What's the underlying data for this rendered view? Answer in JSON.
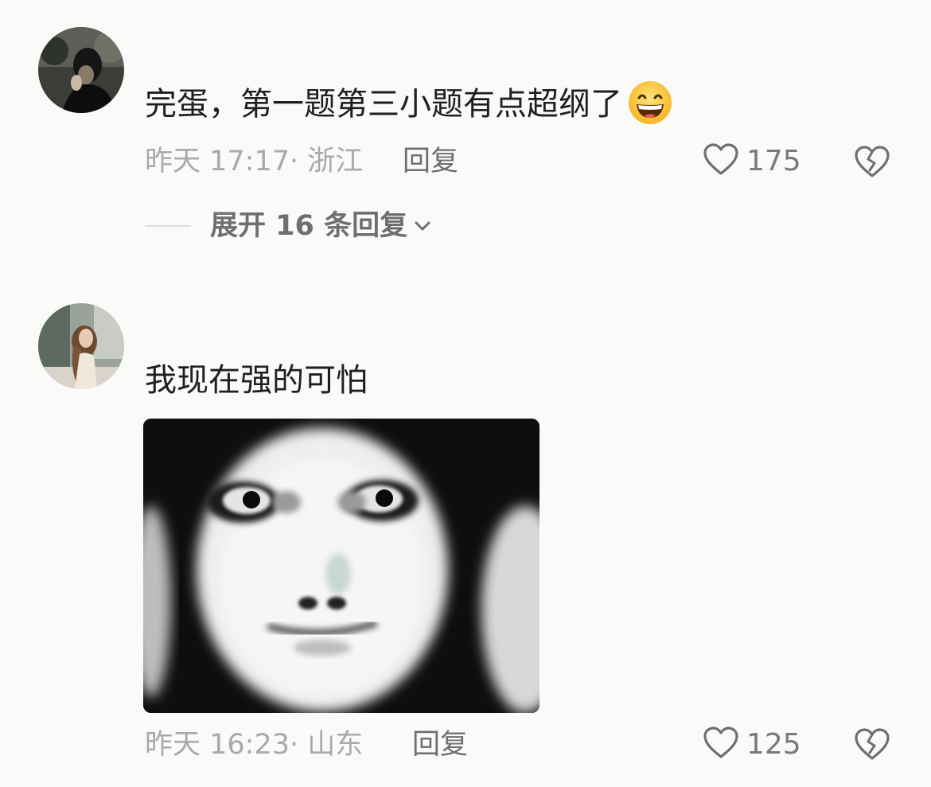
{
  "comments": [
    {
      "text": "完蛋，第一题第三小题有点超纲了",
      "emoji_icon": "grinning-sweat-face-icon",
      "time": "昨天 17:17",
      "location": "浙江",
      "reply_label": "回复",
      "likes": "175",
      "expand_label": "展开 16 条回复"
    },
    {
      "text": "我现在强的可怕",
      "sticker": "face-meme-sticker",
      "time": "昨天 16:23",
      "location": "山东",
      "reply_label": "回复",
      "likes": "125"
    }
  ],
  "separator": "·",
  "colors": {
    "background": "#fafaf9",
    "text_primary": "#1f1f1f",
    "text_meta": "#a9a9a9",
    "text_action": "#6e6e6e"
  }
}
